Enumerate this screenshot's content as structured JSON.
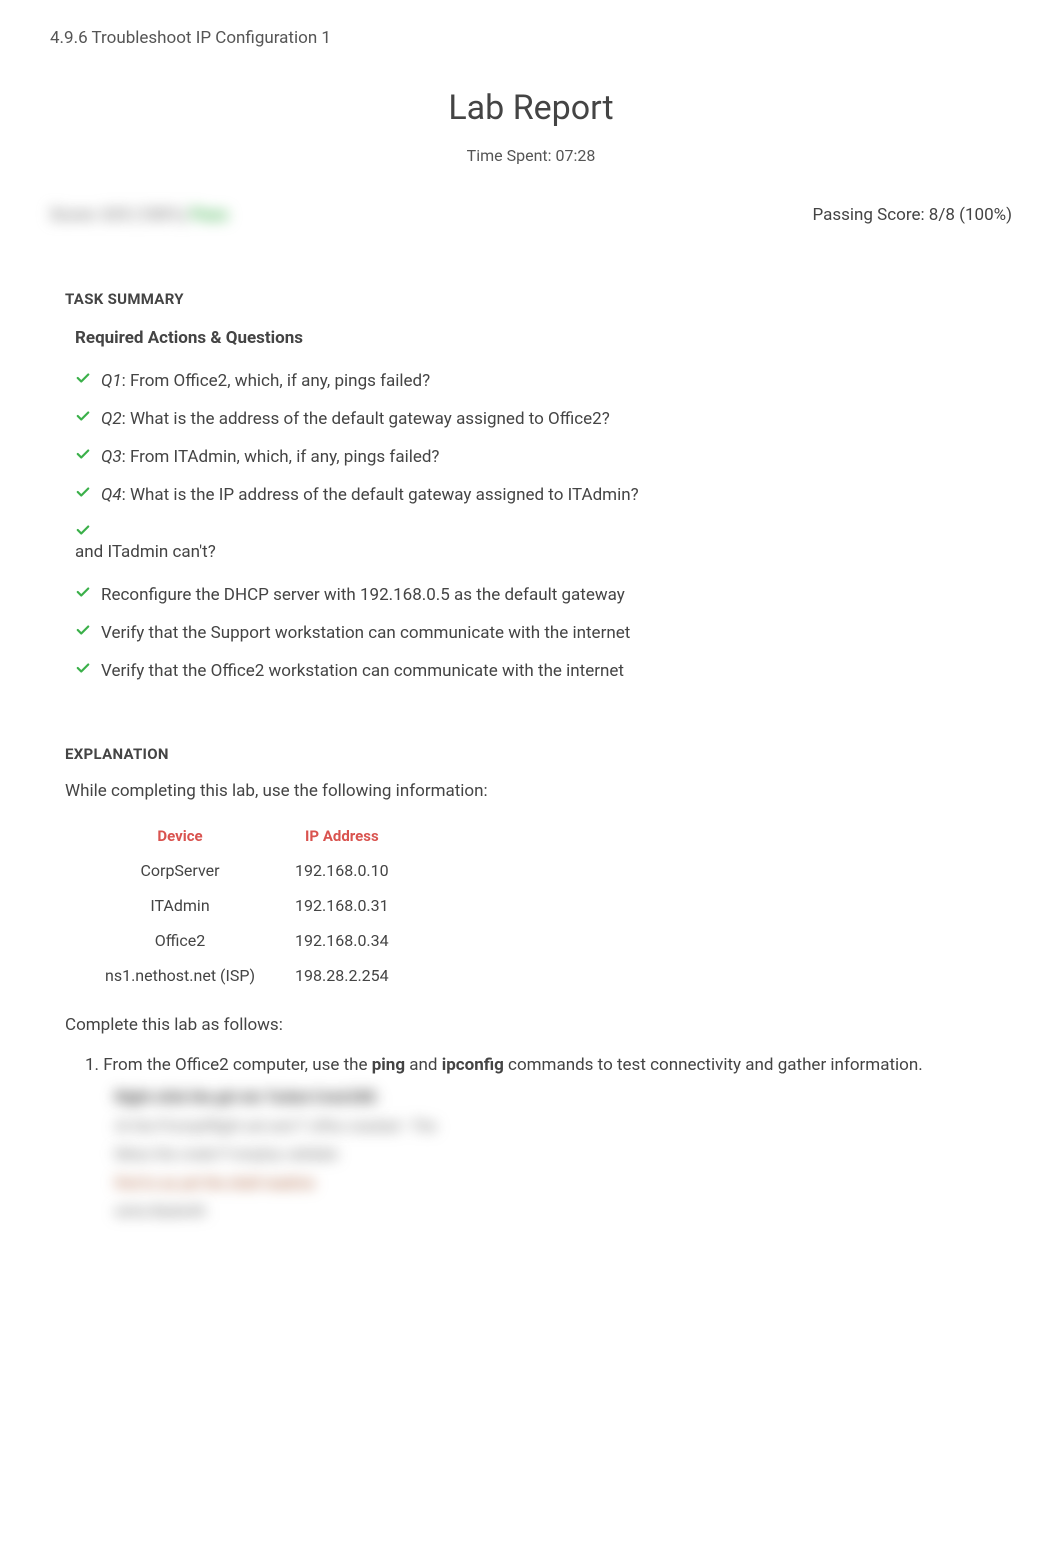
{
  "header": {
    "breadcrumb": "4.9.6 Troubleshoot IP Configuration 1"
  },
  "report": {
    "title": "Lab Report",
    "time_spent_label": "Time Spent: 07:28",
    "score_blur": "Score: 8/8 (100%)",
    "score_blur_pass": "Pass",
    "passing_score": "Passing Score: 8/8 (100%)"
  },
  "task_summary": {
    "title": "TASK SUMMARY",
    "required_title": "Required Actions & Questions",
    "items": [
      {
        "qnum": "Q1",
        "text": ":  From Office2, which, if any, pings failed?"
      },
      {
        "qnum": "Q2",
        "text": ":  What is the address of the default gateway assigned to Office2?"
      },
      {
        "qnum": "Q3",
        "text": ":  From ITAdmin, which, if any, pings failed?"
      },
      {
        "qnum": "Q4",
        "text": ":  What is the IP address of the default gateway assigned to ITAdmin?"
      }
    ],
    "orphan": "and ITadmin can't?",
    "items2": [
      "Reconfigure the DHCP server with 192.168.0.5 as the default gateway",
      "Verify that the Support workstation can communicate with the internet",
      "Verify that the Office2 workstation can communicate with the internet"
    ]
  },
  "explanation": {
    "title": "EXPLANATION",
    "intro": "While completing this lab, use the following information:",
    "table": {
      "headers": [
        "Device",
        "IP Address"
      ],
      "rows": [
        [
          "CorpServer",
          "192.168.0.10"
        ],
        [
          "ITAdmin",
          "192.168.0.31"
        ],
        [
          "Office2",
          "192.168.0.34"
        ],
        [
          "ns1.nethost.net (ISP)",
          "198.28.2.254"
        ]
      ]
    },
    "complete_intro": "Complete this lab as follows:",
    "step1_prefix": "1. From the Office2 computer, use the ",
    "step1_bold1": "ping",
    "step1_mid": " and ",
    "step1_bold2": "ipconfig",
    "step1_suffix": " commands to test connectivity and gather information.",
    "blur_lines": [
      "Right-click the    giri etc     Turbot Cmd.EXE",
      "At the Promptflight set        and T ofhis cracked - The",
      "Mess the     creek P employ      validate",
      "find to as yet the     shell readme",
      "extra Badwith"
    ]
  }
}
